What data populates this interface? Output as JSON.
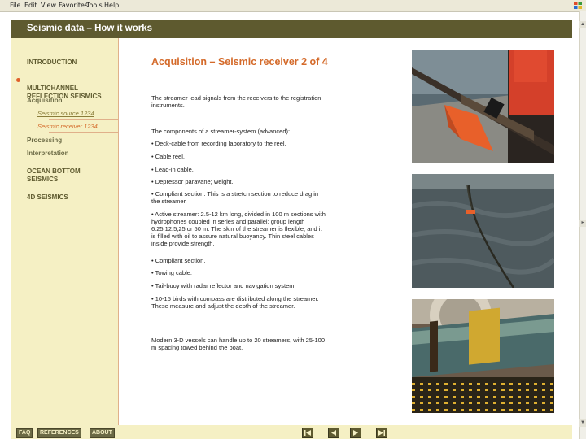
{
  "menu": [
    "File",
    "Edit",
    "View",
    "Favorites",
    "Tools",
    "Help"
  ],
  "header": {
    "title": "Seismic data – How it works"
  },
  "sidebar": {
    "items": [
      {
        "label": "INTRODUCTION"
      },
      {
        "label": "MULTICHANNEL REFLECTION SEISMICS",
        "active": true
      },
      {
        "label": "Acquisition"
      },
      {
        "label": "Seismic source  1234"
      },
      {
        "label": "Seismic receiver  1234",
        "current": true
      },
      {
        "label": "Processing"
      },
      {
        "label": "Interpretation"
      },
      {
        "label": "OCEAN BOTTOM SEISMICS"
      },
      {
        "label": "4D SEISMICS"
      }
    ]
  },
  "main": {
    "title": "Acquisition – Seismic receiver 2 of 4",
    "intro": "The streamer lead signals from the receivers to the registration instruments.",
    "components_heading": "The components of a streamer-system (advanced):",
    "components": [
      "• Deck-cable from recording laboratory to the reel.",
      "• Cable reel.",
      "• Lead-in cable.",
      "• Depressor paravane; weight.",
      "• Compliant section. This is a stretch section to reduce drag in the streamer.",
      "• Active streamer: 2.5-12 km long, divided in 100 m sections with hydrophones coupled in series and parallel; group length 6.25,12.5,25 or 50 m. The skin of the streamer is flexible, and it is filled with oil to assure natural buoyancy. Thin steel cables inside provide strength.",
      "• Compliant section.",
      "• Towing cable.",
      "• Tail-buoy with radar reflector and navigation system.",
      "• 10-15 birds with compass are distributed along the streamer. These measure and adjust the depth of the streamer."
    ],
    "closing": "Modern 3-D vessels can handle up to 20 streamers, with 25-100 m spacing towed behind the boat."
  },
  "footer": {
    "faq": "FAQ",
    "references": "REFERENCES",
    "about": "ABOUT"
  },
  "colors": {
    "header_bg": "#5e5a2f",
    "sidebar_bg": "#f5f0c4",
    "accent": "#d46a2a",
    "nav_text": "#5e5a2f"
  }
}
